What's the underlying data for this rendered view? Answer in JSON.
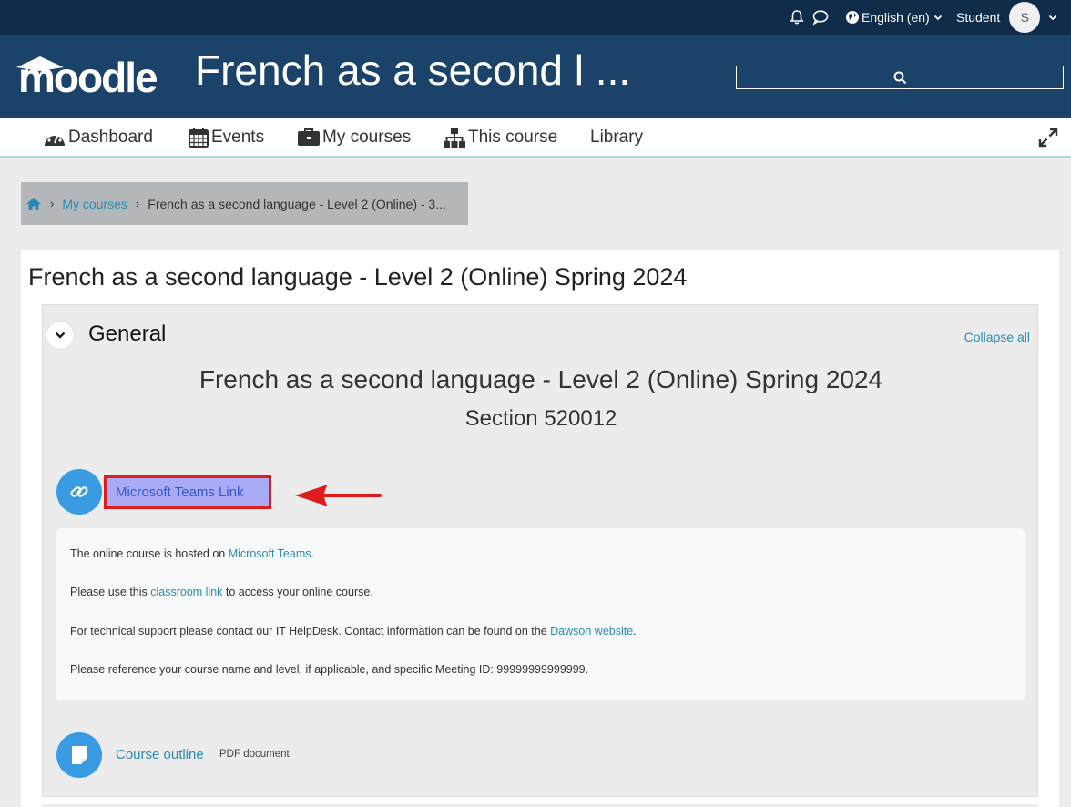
{
  "topbar": {
    "language": "English (en)",
    "user_name": "Student",
    "avatar_initial": "S",
    "icons": [
      "bell-icon",
      "chat-icon",
      "globe-icon",
      "chevron-down-icon"
    ]
  },
  "header": {
    "logo_text": "moodle",
    "site_title": "French as a second l ..."
  },
  "nav": {
    "items": [
      {
        "label": "Dashboard",
        "icon": "dashboard-icon"
      },
      {
        "label": "Events",
        "icon": "calendar-icon"
      },
      {
        "label": "My courses",
        "icon": "briefcase-icon"
      },
      {
        "label": "This course",
        "icon": "sitemap-icon"
      },
      {
        "label": "Library",
        "icon": ""
      }
    ]
  },
  "breadcrumb": {
    "home_icon": "home-icon",
    "my_courses": "My courses",
    "current": "French as a second language - Level 2 (Online) - 3..."
  },
  "page": {
    "title": "French as a second language - Level 2 (Online) Spring 2024"
  },
  "section": {
    "name": "General",
    "collapse_all": "Collapse all",
    "course_heading": "French as a second language - Level 2 (Online) Spring 2024",
    "section_heading": "Section 520012",
    "teams_link": "Microsoft Teams Link",
    "info": {
      "line1_pre": "The online course is hosted on ",
      "line1_link": "Microsoft Teams",
      "line1_post": ".",
      "line2_pre": "Please use this ",
      "line2_link": "classroom link",
      "line2_post": " to access your online course.",
      "line3_pre": "For technical support please contact our IT HelpDesk. Contact information can be found on the ",
      "line3_link": "Dawson website",
      "line3_post": ".",
      "line4": "Please reference your course name and level, if applicable, and specific Meeting ID: 99999999999999."
    },
    "outline_link": "Course outline",
    "outline_type": "PDF document"
  },
  "colors": {
    "topbar": "#0f2d4a",
    "header": "#1b4268",
    "link": "#2a8ab5",
    "activity_icon": "#399be2",
    "highlight_border": "#e01b1b",
    "highlight_fill": "#a9abf6"
  }
}
